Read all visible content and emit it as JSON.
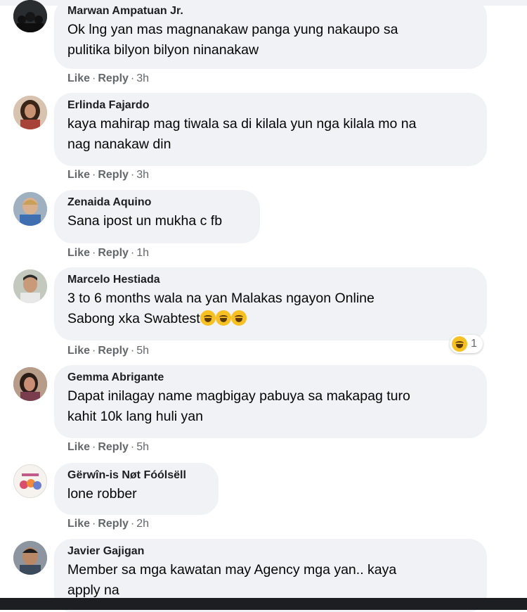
{
  "comments": [
    {
      "author": "Marwan Ampatuan Jr.",
      "lines": [
        "Ok lng yan mas magnanakaw panga yung nakaupo sa",
        "pulitika bilyon bilyon ninanakaw"
      ],
      "like": "Like",
      "reply": "Reply",
      "time": "3h"
    },
    {
      "author": "Erlinda Fajardo",
      "lines": [
        "kaya mahirap mag tiwala sa di kilala yun nga kilala mo na",
        "nag nanakaw din"
      ],
      "like": "Like",
      "reply": "Reply",
      "time": "3h"
    },
    {
      "author": "Zenaida Aquino",
      "lines": [
        "Sana ipost un mukha c fb"
      ],
      "like": "Like",
      "reply": "Reply",
      "time": "1h"
    },
    {
      "author": "Marcelo Hestiada",
      "lines": [
        "3 to 6 months wala na yan Malakas ngayon Online",
        "Sabong xka Swabtest"
      ],
      "like": "Like",
      "reply": "Reply",
      "time": "5h",
      "reaction_count": "1"
    },
    {
      "author": "Gemma Abrigante",
      "lines": [
        "Dapat inilagay name magbigay pabuya sa makapag turo",
        "kahit 10k lang huli yan"
      ],
      "like": "Like",
      "reply": "Reply",
      "time": "5h"
    },
    {
      "author": "Gërwîn-is Nøt Fóólsëll",
      "lines": [
        "lone robber"
      ],
      "like": "Like",
      "reply": "Reply",
      "time": "2h"
    },
    {
      "author": "Javier Gajigan",
      "lines": [
        "Member sa mga kawatan may Agency mga yan.. kaya",
        "apply na"
      ]
    }
  ],
  "colors": {
    "bubble": "#f0f2f5",
    "action_text": "#65676b",
    "emoji": "#f7c023"
  },
  "icons": {
    "reaction": "laughing-tears-emoji-icon"
  }
}
